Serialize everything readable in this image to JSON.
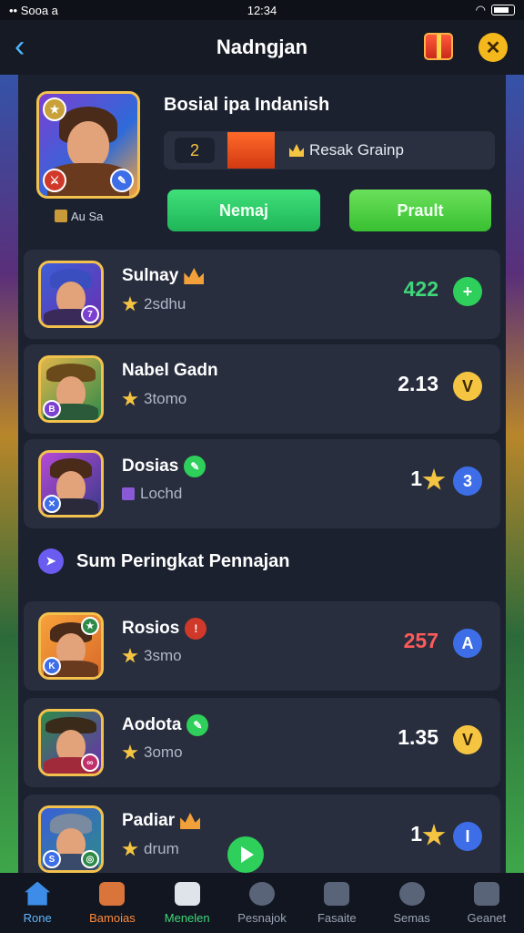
{
  "status_bar": {
    "left": "•• Sooa a",
    "time": "12:34"
  },
  "header": {
    "title": "Nadngjan",
    "close_symbol": "✕",
    "back_symbol": "‹"
  },
  "hero": {
    "title": "Bosial ipa Indanish",
    "level": "2",
    "stat_label": "Resak Grainp",
    "tag": "Au Sa",
    "button_left": "Nemaj",
    "button_right": "Prault"
  },
  "top_list": [
    {
      "name": "Sulnay",
      "sub": "2sdhu",
      "score": "422",
      "score_color": "#3fd77a",
      "action": "+",
      "action_color": "#2ecf5a",
      "badge_color": "#7b3fd1"
    },
    {
      "name": "Nabel Gadn",
      "sub": "3tomo",
      "score": "2.13",
      "score_color": "#ffffff",
      "action": "V",
      "action_color": "#f5c542",
      "badge_color": "#7b3fd1"
    },
    {
      "name": "Dosias",
      "sub": "Lochd",
      "score": "1",
      "score_color": "#ffffff",
      "action": "3",
      "action_color": "#3d6ee8",
      "badge_color": "#3d6ee8"
    }
  ],
  "section_title": "Sum Peringkat Pennajan",
  "bottom_list": [
    {
      "name": "Rosios",
      "sub": "3smo",
      "score": "257",
      "score_color": "#ff5a5a",
      "action": "A",
      "action_color": "#3d6ee8",
      "badge_color": "#3d6ee8"
    },
    {
      "name": "Aodota",
      "sub": "3omo",
      "score": "1.35",
      "score_color": "#ffffff",
      "action": "V",
      "action_color": "#f5c542",
      "badge_color": "#c0306a"
    },
    {
      "name": "Padiar",
      "sub": "drum",
      "score": "1",
      "score_color": "#ffffff",
      "action": "I",
      "action_color": "#3d6ee8",
      "badge_color": "#3d6ee8"
    }
  ],
  "tabs": [
    {
      "label": "Rone",
      "icon": "home-icon"
    },
    {
      "label": "Bamoias",
      "icon": "sword-icon"
    },
    {
      "label": "Menelen",
      "icon": "chat-icon"
    },
    {
      "label": "Pesnajok",
      "icon": "shield-icon"
    },
    {
      "label": "Fasaite",
      "icon": "edit-icon"
    },
    {
      "label": "Semas",
      "icon": "face-icon"
    },
    {
      "label": "Geanet",
      "icon": "profile-icon"
    }
  ]
}
